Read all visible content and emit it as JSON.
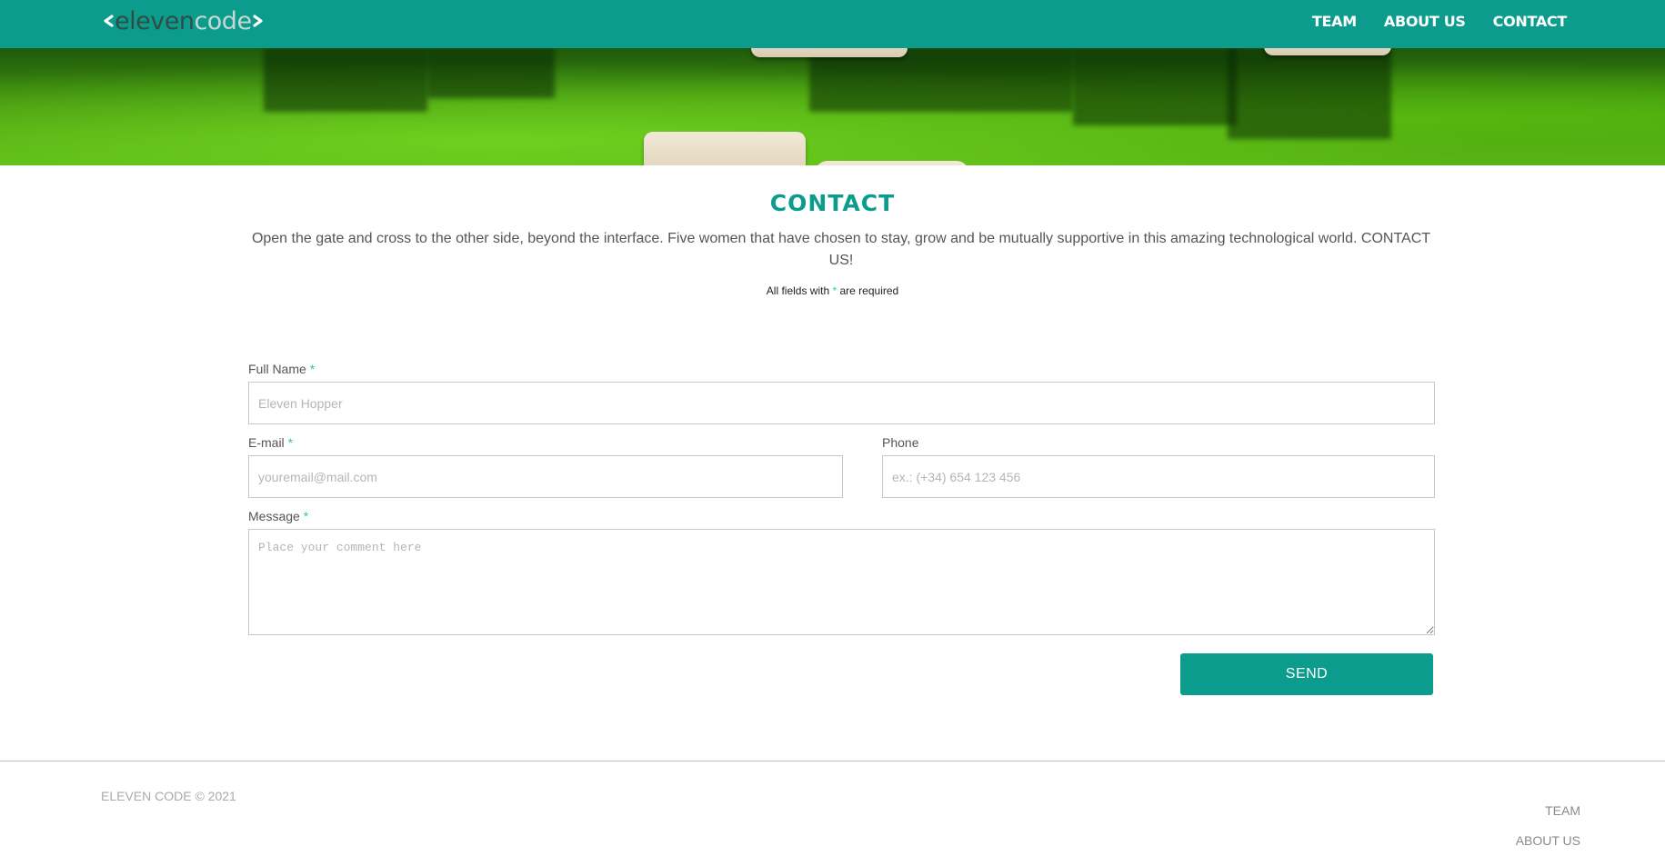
{
  "colors": {
    "brand": "#0c9c8d",
    "asterisk": "#2ec4b6",
    "logo_dark": "#2f4d45",
    "logo_light": "#c9d6d3"
  },
  "header": {
    "logo_word1": "eleven",
    "logo_word2": "code",
    "nav": [
      "TEAM",
      "ABOUT US",
      "CONTACT"
    ]
  },
  "contact": {
    "title": "CONTACT",
    "intro": "Open the gate and cross to the other side, beyond the interface. Five women that have chosen to stay, grow and be mutually supportive in this amazing technological world. CONTACT US!",
    "required_prefix": "All fields with",
    "required_mark": "*",
    "required_suffix": "are required"
  },
  "form": {
    "full_name": {
      "label": "Full Name",
      "required": "*",
      "placeholder": "Eleven Hopper",
      "value": ""
    },
    "email": {
      "label": "E-mail",
      "required": "*",
      "placeholder": "youremail@mail.com",
      "value": ""
    },
    "phone": {
      "label": "Phone",
      "placeholder": "ex.: (+34) 654 123 456",
      "value": ""
    },
    "message": {
      "label": "Message",
      "required": "*",
      "placeholder": "Place your comment here",
      "value": ""
    },
    "send_label": "SEND"
  },
  "footer": {
    "copyright": "ELEVEN CODE © 2021",
    "links": [
      "TEAM",
      "ABOUT US"
    ]
  },
  "icons": [
    "chevron-left-icon",
    "chevron-right-icon"
  ]
}
